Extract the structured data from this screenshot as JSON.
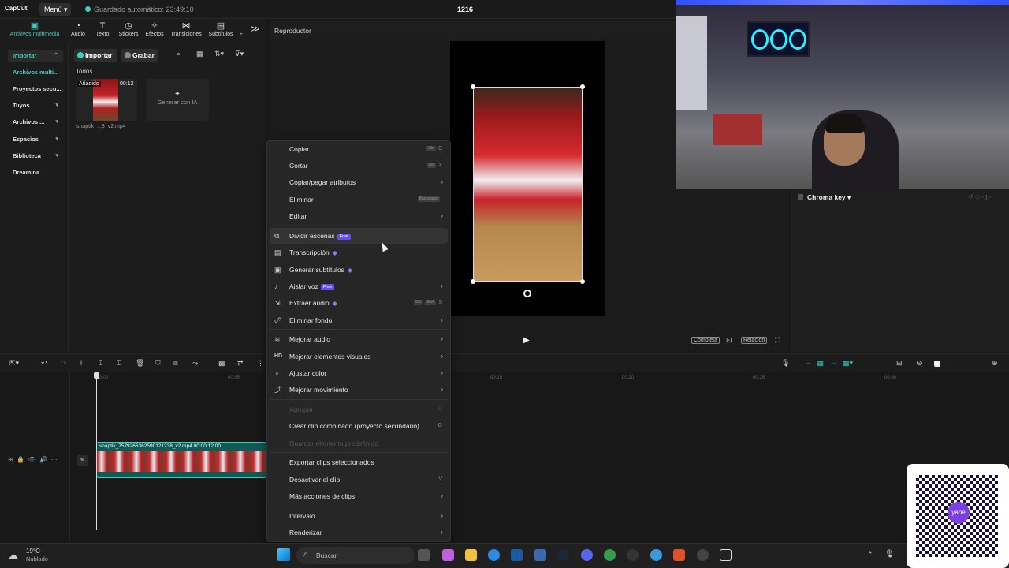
{
  "titlebar": {
    "logo": "CapCut",
    "menu_label": "Menú",
    "autosave": "Guardado automático: 23:49:10",
    "project_title": "1216"
  },
  "toolbar": {
    "tools": [
      "Archivos multimedia",
      "Audio",
      "Texto",
      "Stickers",
      "Efectos",
      "Transiciones",
      "Subtítulos",
      "F"
    ]
  },
  "leftnav": {
    "items": [
      "Importar",
      "Archivos multi...",
      "Proyectos secu...",
      "Tuyos",
      "Archivos ...",
      "Espacios",
      "Biblioteca",
      "Dreamina"
    ]
  },
  "media": {
    "import_label": "Importar",
    "record_label": "Grabar",
    "section": "Todos",
    "clip_tag": "Añadido",
    "clip_duration": "00:12",
    "clip_name": "snaptik_...8_v2.mp4",
    "generate_ai": "Generar con IA"
  },
  "player": {
    "title": "Reproductor",
    "full_label": "Completa",
    "ratio_label": "Relación"
  },
  "right_panel": {
    "chroma_key": "Chroma key"
  },
  "timeline": {
    "ticks": [
      "00:00",
      "00:05",
      "00:15",
      "00:20",
      "00:25",
      "00:30"
    ],
    "track_label": "snaptik_7579266362590121238_v2.mp4  00:00:12:00"
  },
  "context_menu": {
    "items": [
      {
        "label": "Copiar",
        "shortcut": "C",
        "kbd": "Ctrl"
      },
      {
        "label": "Cortar",
        "shortcut": "X",
        "kbd": "Ctrl"
      },
      {
        "label": "Copiar/pegar atributos",
        "submenu": true
      },
      {
        "label": "Eliminar",
        "kbd": "Backspace"
      },
      {
        "label": "Editar",
        "submenu": true
      },
      {
        "label": "Dividir escenas",
        "badge": "Free"
      },
      {
        "label": "Transcripción",
        "gem": true
      },
      {
        "label": "Generar subtítulos",
        "gem": true
      },
      {
        "label": "Aislar voz",
        "badge": "Free",
        "submenu": true
      },
      {
        "label": "Extraer audio",
        "gem": true,
        "shortcut": "S"
      },
      {
        "label": "Eliminar fondo",
        "submenu": true
      },
      {
        "label": "Mejorar audio",
        "submenu": true
      },
      {
        "label": "Mejorar elementos visuales",
        "submenu": true
      },
      {
        "label": "Ajustar color",
        "submenu": true
      },
      {
        "label": "Mejorar movimiento",
        "submenu": true
      },
      {
        "label": "Agrupar",
        "shortcut": "G",
        "disabled": true
      },
      {
        "label": "Crear clip combinado (proyecto secundario)",
        "shortcut": "G"
      },
      {
        "label": "Guardar elemento predefinido",
        "disabled": true
      },
      {
        "label": "Exportar clips seleccionados"
      },
      {
        "label": "Desactivar el clip",
        "shortcut": "V"
      },
      {
        "label": "Más acciones de clips",
        "submenu": true
      },
      {
        "label": "Intervalo",
        "submenu": true
      },
      {
        "label": "Renderizar",
        "submenu": true
      }
    ]
  },
  "taskbar": {
    "temperature": "19°C",
    "weather": "Nublado",
    "search": "Buscar"
  },
  "qr": {
    "brand": "yape"
  },
  "colors": {
    "accent": "#3ad0c0",
    "menu_bg": "#262626",
    "badge": "#6a4cf0"
  }
}
